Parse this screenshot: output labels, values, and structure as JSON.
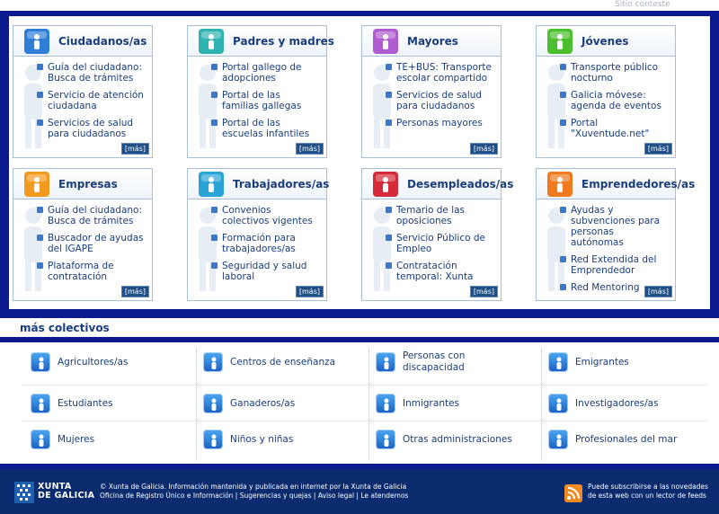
{
  "topbar": {
    "search_hint": "Sitio conteste"
  },
  "cards": [
    {
      "title": "Ciudadanos/as",
      "color": "#2f7fd8",
      "items": [
        "Guía del ciudadano: Busca de trámites",
        "Servicio de atención ciudadana",
        "Servicios de salud para ciudadanos"
      ],
      "more": "[más]"
    },
    {
      "title": "Padres y madres",
      "color": "#2fb3b0",
      "items": [
        "Portal gallego de adopciones",
        "Portal de las familias gallegas",
        "Portal de las escuelas infantiles"
      ],
      "more": "[más]"
    },
    {
      "title": "Mayores",
      "color": "#b05bd0",
      "items": [
        "TE+BUS: Transporte escolar compartido",
        "Servicios de salud para ciudadanos",
        "Personas mayores"
      ],
      "more": "[más]"
    },
    {
      "title": "Jóvenes",
      "color": "#4cbf2f",
      "items": [
        "Transporte público nocturno",
        "Galicia móvese: agenda de eventos",
        "Portal \"Xuventude.net\""
      ],
      "more": "[más]"
    },
    {
      "title": "Empresas",
      "color": "#f29a1e",
      "items": [
        "Guía del ciudadano: Busca de trámites",
        "Buscador de ayudas del IGAPE",
        "Plataforma de contratación"
      ],
      "more": "[más]"
    },
    {
      "title": "Trabajadores/as",
      "color": "#2aa3d6",
      "items": [
        "Convenios colectivos vigentes",
        "Formación para trabajadores/as",
        "Seguridad y salud laboral"
      ],
      "more": "[más]"
    },
    {
      "title": "Desempleados/as",
      "color": "#d52a3a",
      "items": [
        "Temario de las oposiciones",
        "Servicio Público de Empleo",
        "Contratación temporal: Xunta"
      ],
      "more": "[más]"
    },
    {
      "title": "Emprendedores/as",
      "color": "#f07a1e",
      "items": [
        "Ayudas y subvenciones para personas autónomas",
        "Red Extendida del Emprendedor",
        "Red Mentoring"
      ],
      "more": "[más]"
    }
  ],
  "more_collectives": {
    "title": "más colectivos",
    "items": [
      "Agricultores/as",
      "Centros de enseñanza",
      "Personas con discapacidad",
      "Emigrantes",
      "Estudiantes",
      "Ganaderos/as",
      "Inmigrantes",
      "Investigadores/as",
      "Mujeres",
      "Niños y niñas",
      "Otras administraciones",
      "Profesionales del mar"
    ]
  },
  "footer": {
    "logo_line1": "XUNTA",
    "logo_line2": "DE GALICIA",
    "copyright_line1": "© Xunta de Galicia. Información mantenida y publicada en internet por la Xunta de Galicia",
    "copyright_line2": "Oficina de Registro Único e Información | Sugerencias y quejas | Aviso legal | Le atendemos",
    "rss_line1": "Puede subscribirse a las novedades",
    "rss_line2": "de esta web con un lector de feeds"
  }
}
